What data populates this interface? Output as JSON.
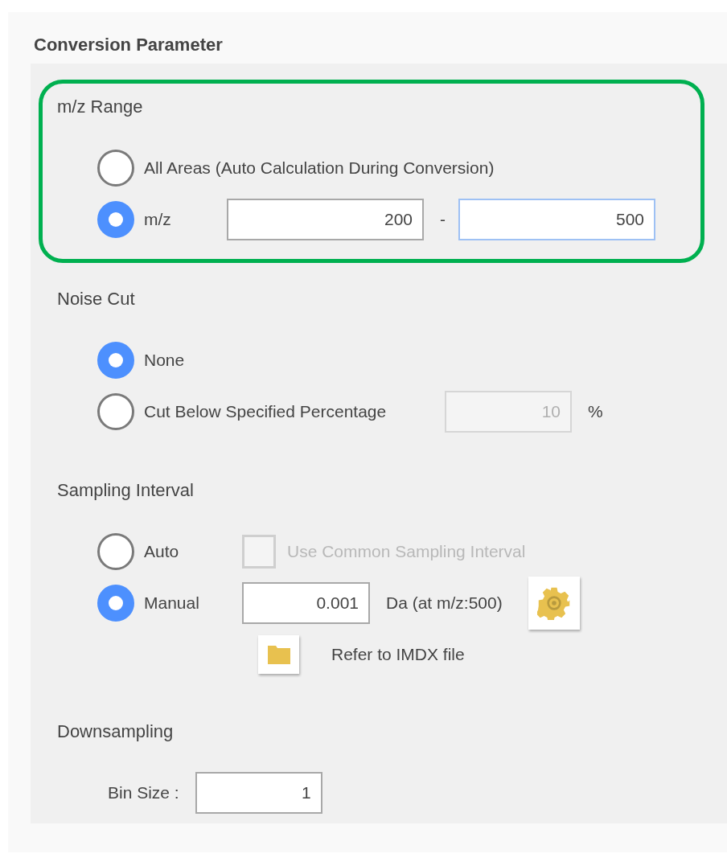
{
  "title": "Conversion Parameter",
  "sections": [
    {
      "heading": "m/z Range",
      "highlighted": true,
      "rows": [
        {
          "parts": [
            {
              "kind": "radio",
              "label": "All Areas (Auto Calculation During Conversion)",
              "selected": false
            }
          ]
        },
        {
          "parts": [
            {
              "kind": "radio",
              "label": "m/z",
              "selected": true
            },
            {
              "kind": "field",
              "value": "200",
              "disabled": false,
              "focused": false
            },
            {
              "kind": "text",
              "text": "-"
            },
            {
              "kind": "field",
              "value": "500",
              "disabled": false,
              "focused": true
            }
          ]
        }
      ]
    },
    {
      "heading": "Noise Cut",
      "rows": [
        {
          "parts": [
            {
              "kind": "radio",
              "label": "None",
              "selected": true
            }
          ]
        },
        {
          "parts": [
            {
              "kind": "radio",
              "label": "Cut Below Specified Percentage",
              "selected": false
            },
            {
              "kind": "field",
              "value": "10",
              "disabled": true,
              "focused": false
            },
            {
              "kind": "text",
              "text": "%"
            }
          ]
        }
      ]
    },
    {
      "heading": "Sampling Interval",
      "rows": [
        {
          "parts": [
            {
              "kind": "radio",
              "label": "Auto",
              "selected": false
            },
            {
              "kind": "checkbox",
              "label": "Use Common Sampling Interval",
              "checked": false,
              "disabled": true
            }
          ]
        },
        {
          "parts": [
            {
              "kind": "radio",
              "label": "Manual",
              "selected": true
            },
            {
              "kind": "field",
              "value": "0.001",
              "disabled": false,
              "focused": false
            },
            {
              "kind": "text",
              "text": "Da (at m/z:500)"
            },
            {
              "kind": "gear_button"
            }
          ]
        },
        {
          "parts": [
            {
              "kind": "folder_button"
            },
            {
              "kind": "text",
              "text": "Refer to IMDX file"
            }
          ]
        }
      ]
    },
    {
      "heading": "Downsampling",
      "rows": [
        {
          "parts": [
            {
              "kind": "text",
              "text": "Bin Size :"
            },
            {
              "kind": "field",
              "value": "1",
              "disabled": false,
              "focused": false
            }
          ]
        }
      ]
    }
  ]
}
